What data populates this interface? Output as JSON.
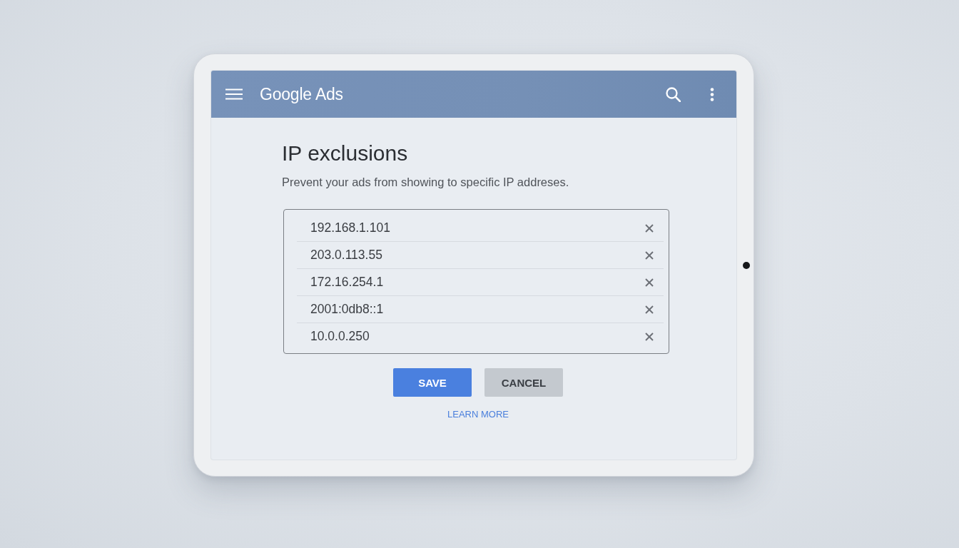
{
  "app_bar": {
    "title": "Google Ads"
  },
  "page": {
    "title": "IP exclusions",
    "description": "Prevent your ads from showing to specific IP addreses."
  },
  "ip_list": [
    {
      "address": "192.168.1.101"
    },
    {
      "address": "203.0.113.55"
    },
    {
      "address": "172.16.254.1"
    },
    {
      "address": "2001:0db8::1"
    },
    {
      "address": "10.0.0.250"
    }
  ],
  "buttons": [
    {
      "label": "SAVE",
      "kind": "primary"
    },
    {
      "label": "CANCEL",
      "kind": "secondary"
    }
  ],
  "link": {
    "label": "LEARN MORE"
  }
}
